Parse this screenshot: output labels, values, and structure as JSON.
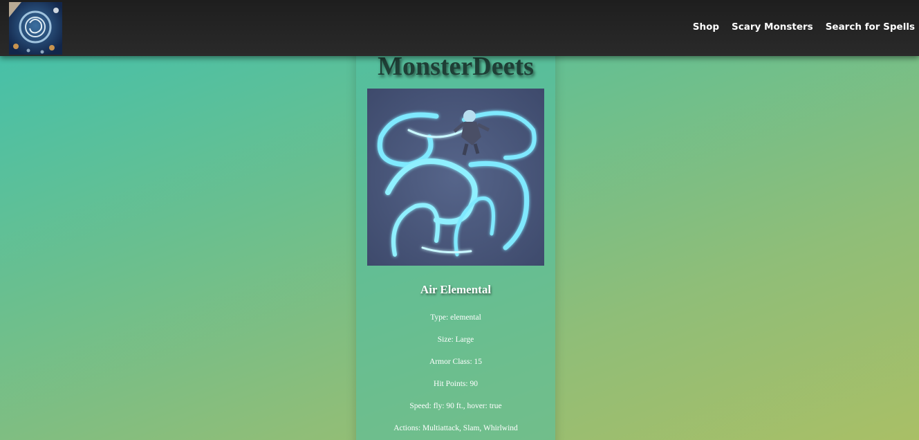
{
  "navbar": {
    "logo": "dragon-medallion-logo",
    "links": [
      "Shop",
      "Scary Monsters",
      "Search for Spells"
    ]
  },
  "main": {
    "site_title": "MonsterDeets",
    "monster": {
      "image": "air-elemental-illustration",
      "name": "Air Elemental",
      "type": "Type: elemental",
      "size": "Size: Large",
      "armor_class": "Armor Class: 15",
      "hit_points": "Hit Points: 90",
      "speed": "Speed: fly: 90 ft., hover: true",
      "actions": "Actions: Multiattack, Slam, Whirlwind"
    }
  },
  "colors": {
    "navbar_bg": "#232323",
    "gradient_start": "#3fc1ae",
    "gradient_end": "#a9bf66",
    "title_text": "#1f3f36",
    "card_text": "#ffffff"
  }
}
